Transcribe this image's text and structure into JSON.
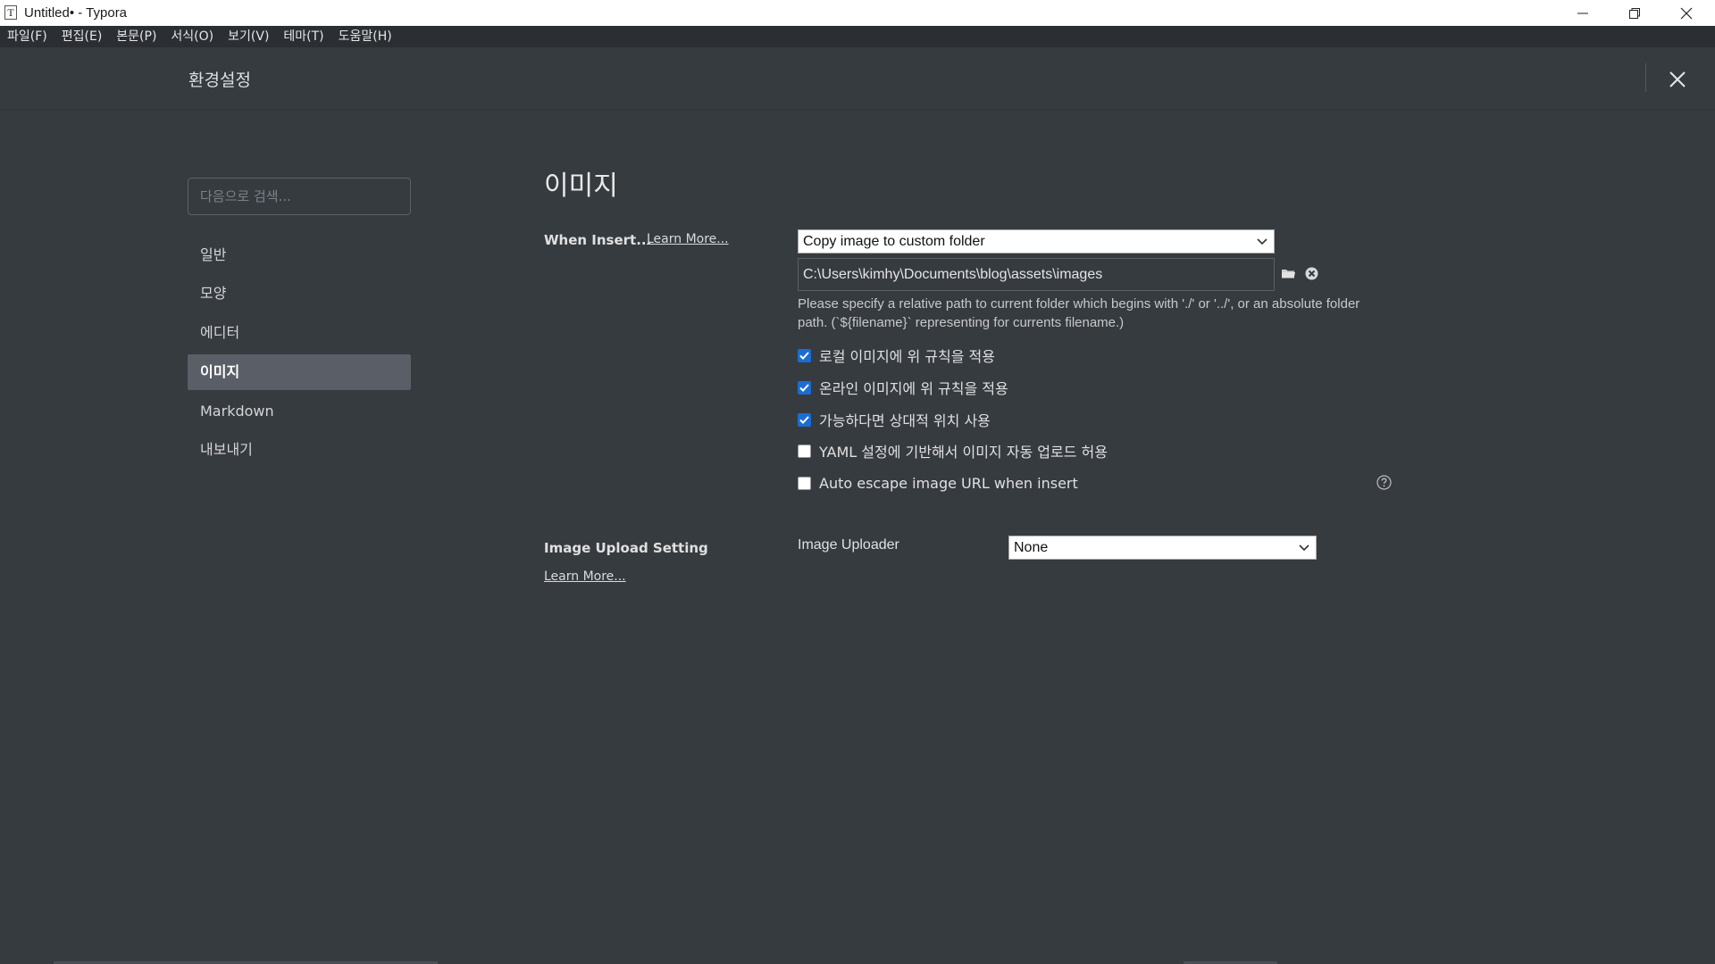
{
  "window": {
    "app_icon": "T",
    "title": "Untitled• - Typora",
    "icons": [
      "minimize-icon",
      "restore-icon",
      "close-icon"
    ]
  },
  "menu": [
    "파일(F)",
    "편집(E)",
    "본문(P)",
    "서식(O)",
    "보기(V)",
    "테마(T)",
    "도움말(H)"
  ],
  "preferences": {
    "title": "환경설정",
    "search_placeholder": "다음으로 검색...",
    "nav": [
      "일반",
      "모양",
      "에디터",
      "이미지",
      "Markdown",
      "내보내기"
    ],
    "active_nav": "이미지"
  },
  "image_section": {
    "title": "이미지",
    "when_insert_label": "When Insert...",
    "learn_more": "Learn More...",
    "insert_action": "Copy image to custom folder",
    "folder_path": "C:\\Users\\kimhy\\Documents\\blog\\assets\\images",
    "hint": " Please specify a relative path to current folder which begins with './' or '../', or an absolute folder path. (`${filename}` representing for currents filename.)",
    "options": [
      {
        "label": "로컬 이미지에 위 규칙을 적용",
        "checked": true
      },
      {
        "label": "온라인 이미지에 위 규칙을 적용",
        "checked": true
      },
      {
        "label": "가능하다면 상대적 위치 사용",
        "checked": true
      },
      {
        "label": "YAML 설정에 기반해서 이미지 자동 업로드 허용",
        "checked": false
      },
      {
        "label": "Auto escape image URL when insert",
        "checked": false
      }
    ]
  },
  "upload_section": {
    "title": "Image Upload Setting",
    "learn_more": "Learn More...",
    "uploader_label": "Image Uploader",
    "uploader_value": "None"
  },
  "colors": {
    "background": "#363b40",
    "checkbox_accent": "#1c6cd6",
    "active_nav": "#5a5e66"
  }
}
